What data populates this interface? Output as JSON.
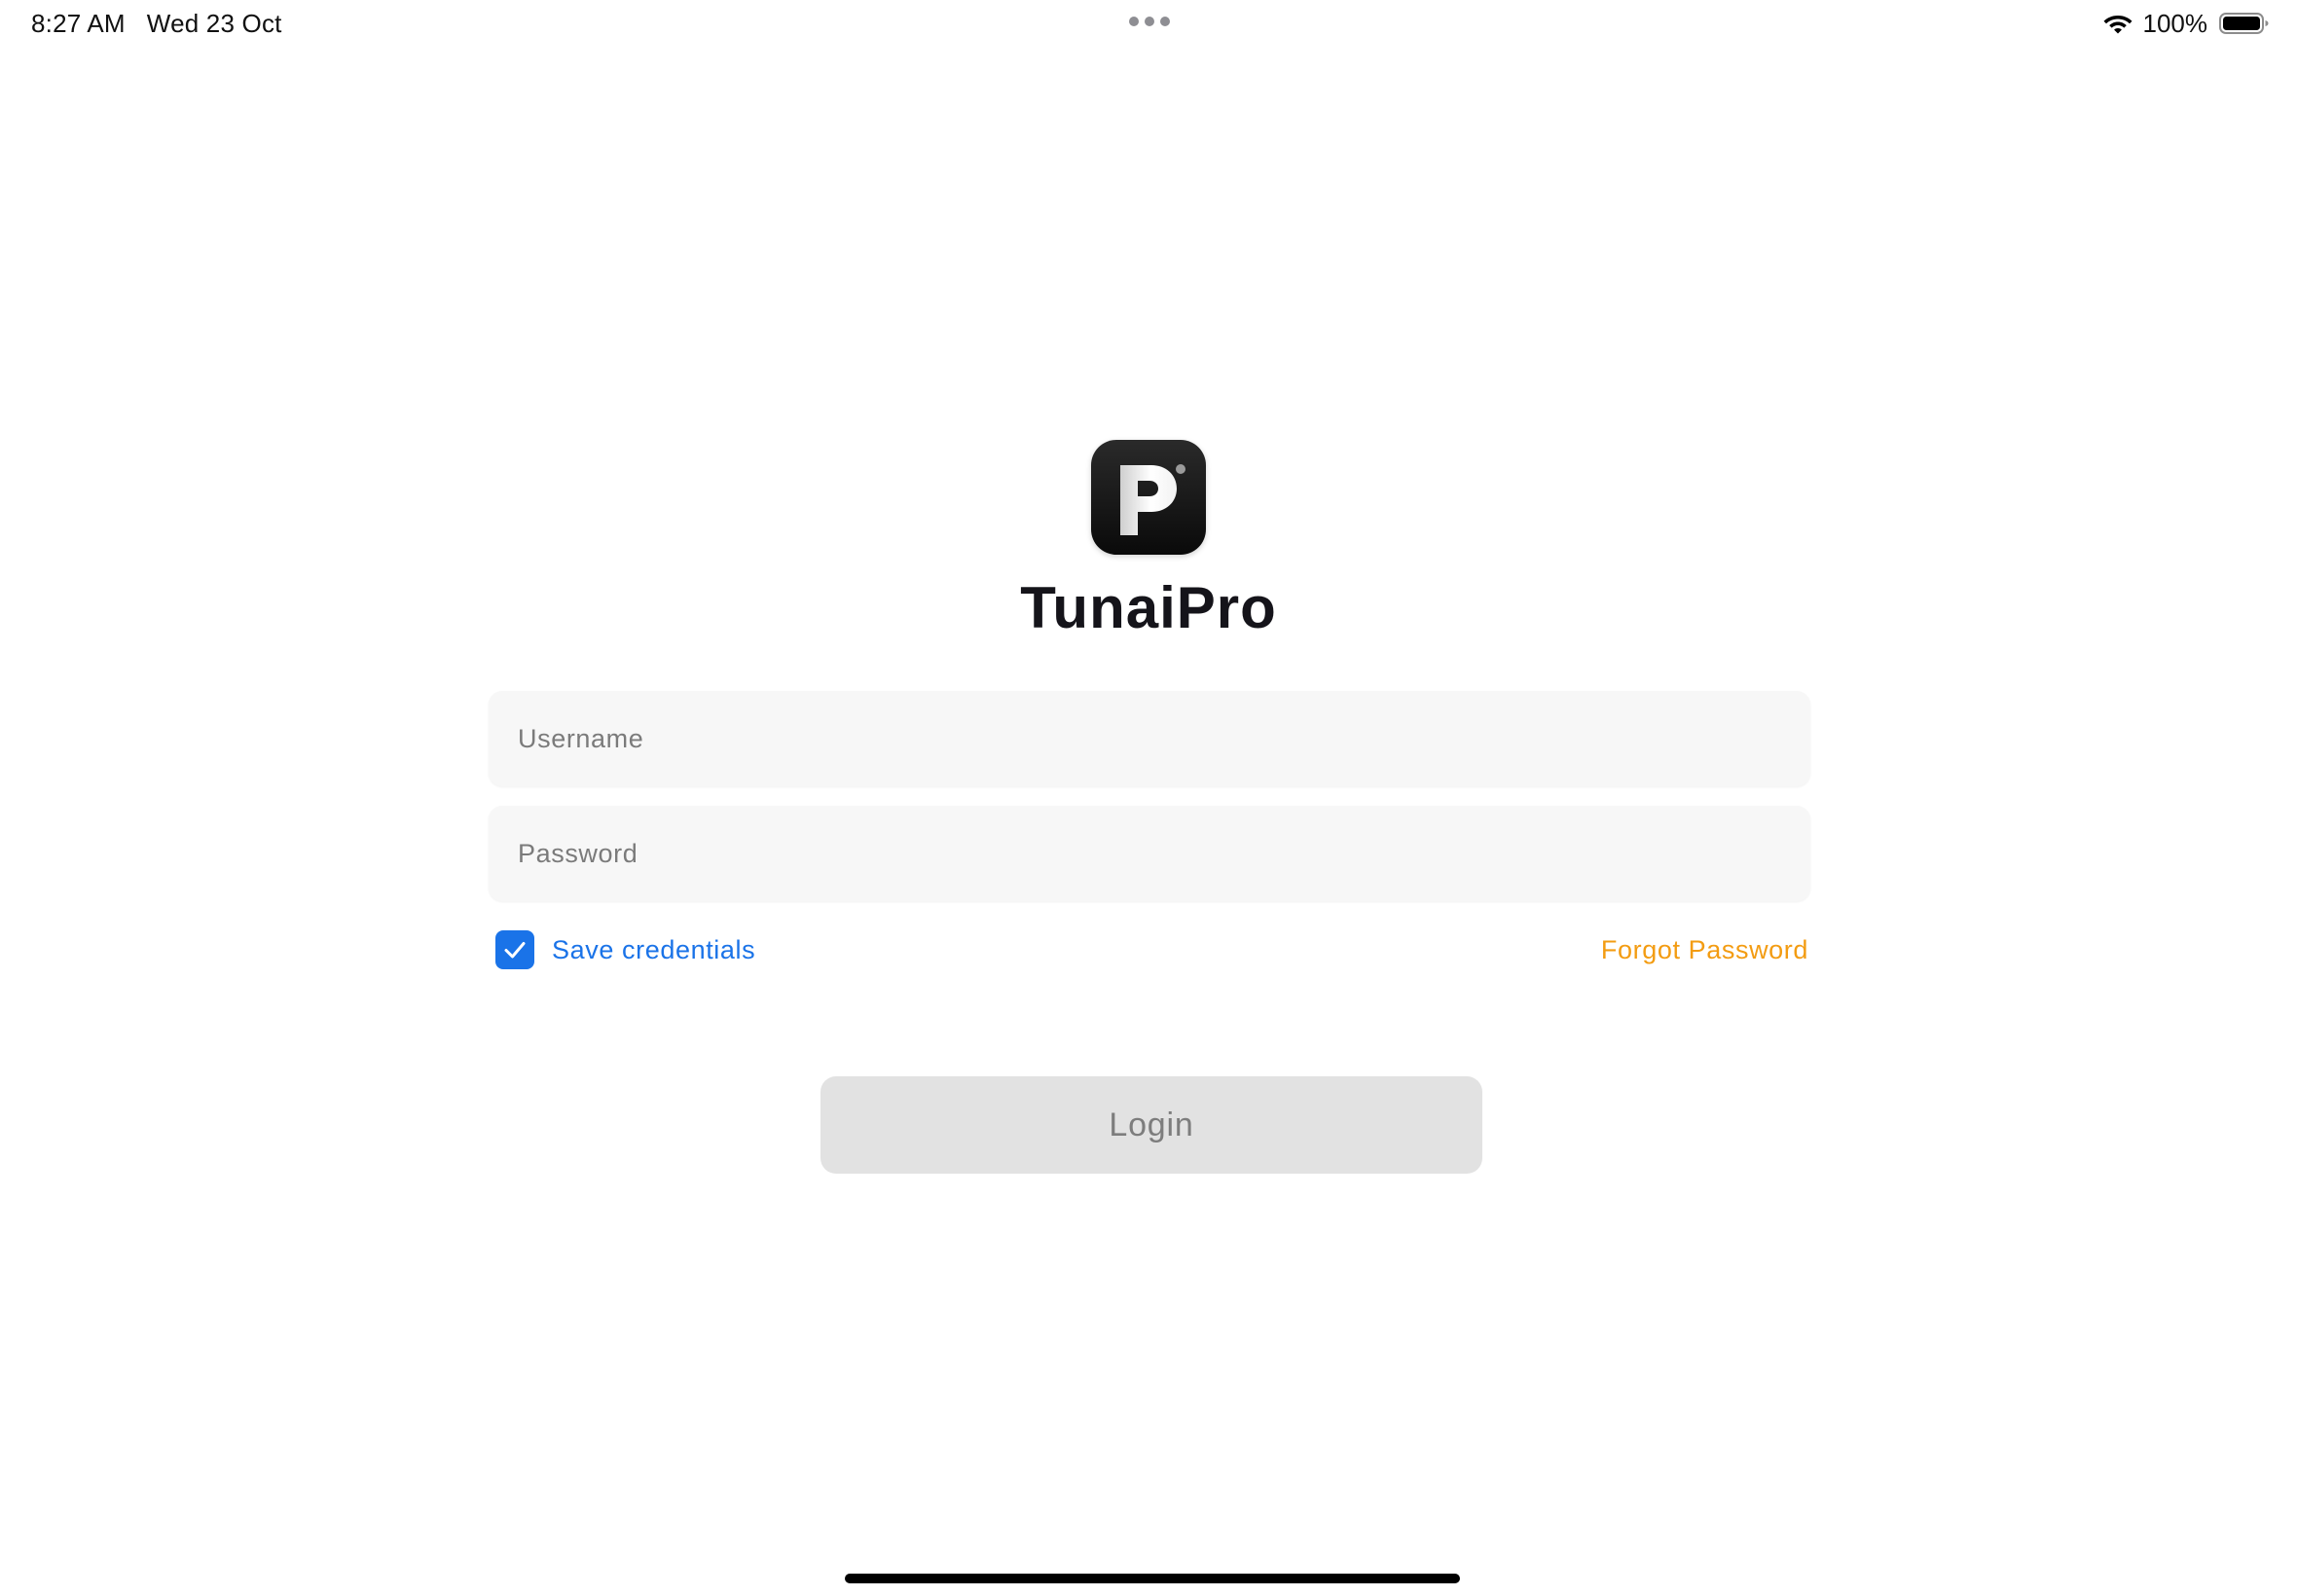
{
  "status_bar": {
    "time": "8:27 AM",
    "date": "Wed 23 Oct",
    "battery_percent": "100%",
    "wifi_icon": "wifi-icon",
    "battery_icon": "battery-full-icon"
  },
  "app": {
    "name": "TunaiPro",
    "logo_icon": "tunaipro-logo-icon"
  },
  "form": {
    "username_placeholder": "Username",
    "username_value": "",
    "password_placeholder": "Password",
    "password_value": "",
    "save_credentials_label": "Save credentials",
    "save_credentials_checked": true,
    "forgot_password_label": "Forgot Password",
    "login_label": "Login"
  },
  "colors": {
    "accent_blue": "#1a73e8",
    "link_orange": "#f39c12",
    "login_disabled_bg": "#e2e2e2",
    "field_bg": "#f7f7f7"
  }
}
